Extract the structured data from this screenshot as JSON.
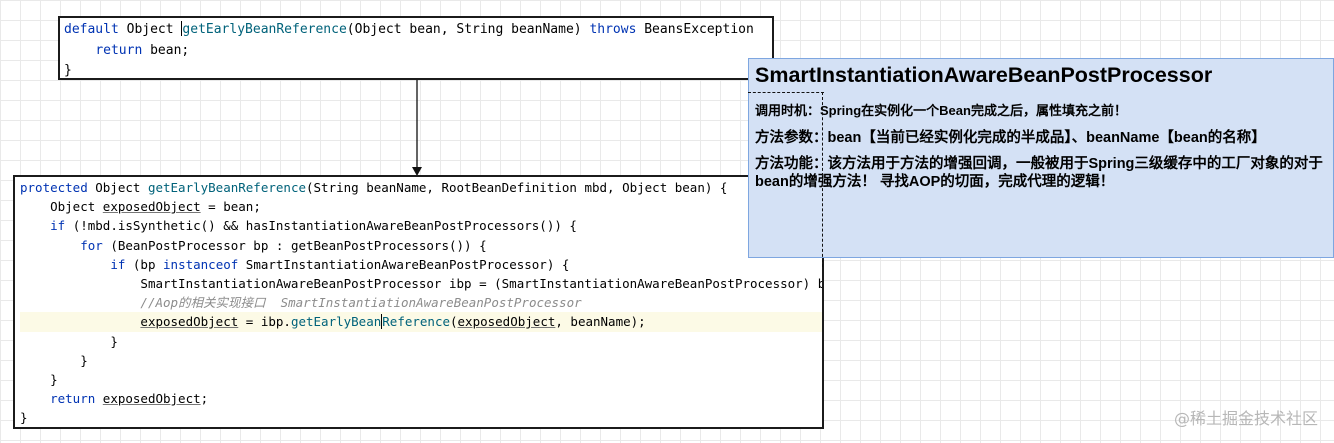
{
  "top_code": {
    "l1_a": "default",
    "l1_b": " Object ",
    "l1_c": "getEarlyBeanReference",
    "l1_d": "(Object bean, String beanName) ",
    "l1_e": "throws",
    "l1_f": " BeansException",
    "l2_a": "return",
    "l2_b": " bean;",
    "l3": "}"
  },
  "bottom_code": {
    "l1_a": "protected",
    "l1_b": " Object ",
    "l1_c": "getEarlyBeanReference",
    "l1_d": "(String beanName, RootBeanDefinition mbd, Object bean) {",
    "l2_a": "Object ",
    "l2_b": "exposedObject",
    "l2_c": " = bean;",
    "l3_a": "if",
    "l3_b": " (!mbd.isSynthetic() && hasInstantiationAwareBeanPostProcessors()) {",
    "l4_a": "for",
    "l4_b": " (BeanPostProcessor bp : getBeanPostProcessors()) {",
    "l5_a": "if",
    "l5_b": " (bp ",
    "l5_c": "instanceof",
    "l5_d": " SmartInstantiationAwareBeanPostProcessor) {",
    "l6": "SmartInstantiationAwareBeanPostProcessor ibp = (SmartInstantiationAwareBeanPostProcessor) bp;",
    "l7": "//Aop的相关实现接口  SmartInstantiationAwareBeanPostProcessor",
    "l8_a": "exposedObject",
    "l8_b": " = ibp.",
    "l8_c": "getEarlyBean",
    "l8_d": "Reference",
    "l8_e": "(",
    "l8_f": "exposedObject",
    "l8_g": ", beanName);",
    "l9": "}",
    "l10": "}",
    "l11": "}",
    "l12_a": "return",
    "l12_b": " ",
    "l12_c": "exposedObject",
    "l12_d": ";",
    "l13": "}"
  },
  "note": {
    "title": "SmartInstantiationAwareBeanPostProcessor",
    "timing": "调用时机：Spring在实例化一个Bean完成之后，属性填充之前！",
    "params": "方法参数：bean【当前已经实例化完成的半成品】、beanName【bean的名称】",
    "function": "方法功能：该方法用于方法的增强回调，一般被用于Spring三级缓存中的工厂对象的对于bean的增强方法！ 寻找AOP的切面，完成代理的逻辑！"
  },
  "watermark": "@稀土掘金技术社区",
  "colors": {
    "keyword": "#0033b3",
    "method": "#00627a",
    "comment": "#8c8c8c",
    "note_bg": "#d4e1f5",
    "note_border": "#7ea6e0"
  }
}
